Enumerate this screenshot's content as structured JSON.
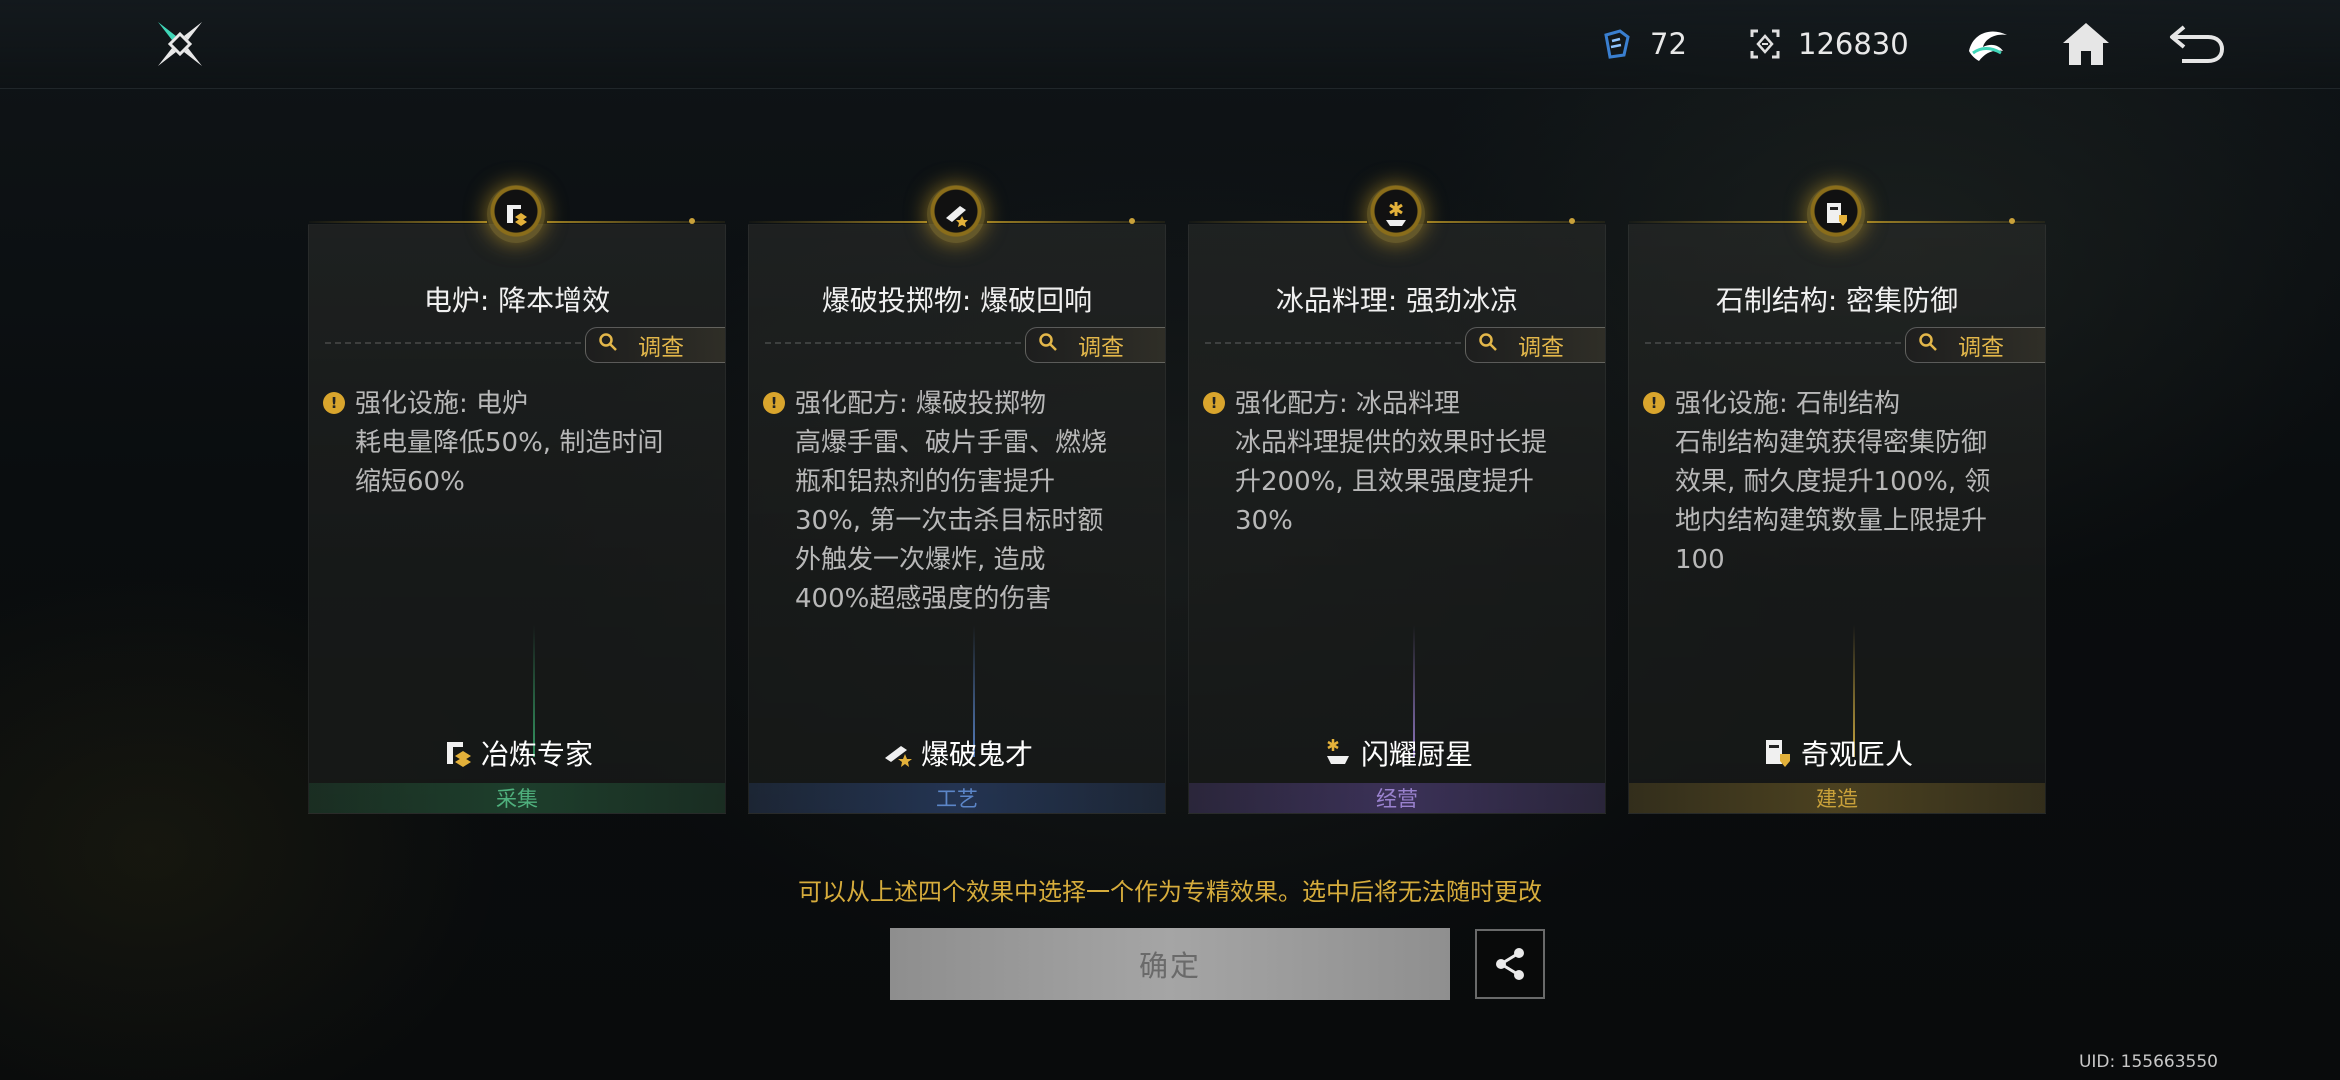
{
  "header": {
    "stamina": "72",
    "currency": "126830"
  },
  "cards": [
    {
      "title": "电炉: 降本增效",
      "investigate_label": "调查",
      "effect_lines": [
        "强化设施: 电炉",
        "耗电量降低50%, 制造时间",
        "缩短60%"
      ],
      "role": "冶炼专家",
      "category": "采集",
      "accent": "#3fbf7a"
    },
    {
      "title": "爆破投掷物: 爆破回响",
      "investigate_label": "调查",
      "effect_lines": [
        "强化配方: 爆破投掷物",
        "高爆手雷、破片手雷、燃烧",
        "瓶和铝热剂的伤害提升",
        "30%, 第一次击杀目标时额",
        "外触发一次爆炸, 造成",
        "400%超感强度的伤害"
      ],
      "role": "爆破鬼才",
      "category": "工艺",
      "accent": "#4a78c8"
    },
    {
      "title": "冰品料理: 强劲冰凉",
      "investigate_label": "调查",
      "effect_lines": [
        "强化配方: 冰品料理",
        "冰品料理提供的效果时长提",
        "升200%, 且效果强度提升",
        "30%"
      ],
      "role": "闪耀厨星",
      "category": "经营",
      "accent": "#8a62c8"
    },
    {
      "title": "石制结构: 密集防御",
      "investigate_label": "调查",
      "effect_lines": [
        "强化设施: 石制结构",
        "石制结构建筑获得密集防御",
        "效果, 耐久度提升100%, 领",
        "地内结构建筑数量上限提升",
        "100"
      ],
      "role": "奇观匠人",
      "category": "建造",
      "accent": "#c9a13a"
    }
  ],
  "instruction": "可以从上述四个效果中选择一个作为专精效果。选中后将无法随时更改",
  "confirm_label": "确定",
  "uid": "UID: 155663550"
}
